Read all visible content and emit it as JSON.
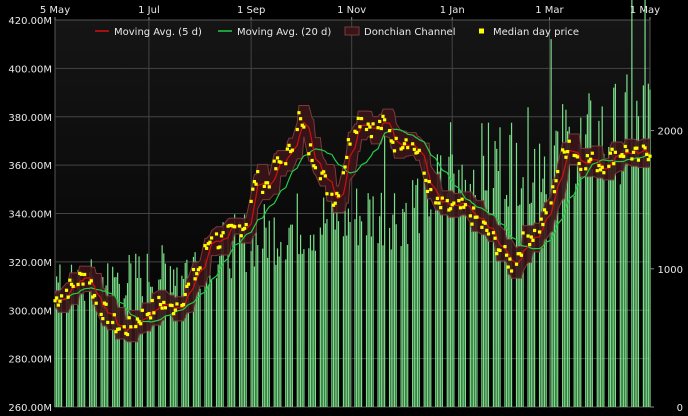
{
  "chart_data": {
    "type": "line",
    "grid": true,
    "legend_placement": "top",
    "colors": {
      "ma5": "#d01010",
      "ma20": "#22cc44",
      "donchian_fill": "#3a1418",
      "donchian_line": "#7a3a3a",
      "median": "#ffff00",
      "volume": "#7be08a",
      "plot_bg_top": "#101010",
      "plot_bg_bottom": "#000000",
      "grid": "#444444",
      "text": "#e8e8e8"
    },
    "x_axis": {
      "ticks": [
        "5 May",
        "1 Jul",
        "1 Sep",
        "1 Nov",
        "1 Jan",
        "1 Mar",
        "1 May"
      ],
      "tick_days": [
        0,
        57,
        119,
        180,
        241,
        300,
        361
      ],
      "range_days": [
        0,
        361
      ]
    },
    "y_axis": {
      "ticks": [
        "420.00M",
        "400.00M",
        "380.00M",
        "360.00M",
        "340.00M",
        "320.00M",
        "300.00M",
        "280.00M",
        "260.00M"
      ],
      "tick_values": [
        420,
        400,
        380,
        360,
        340,
        320,
        300,
        280,
        260
      ],
      "unit": "M",
      "range": [
        260,
        420
      ]
    },
    "volume_axis": {
      "ticks": [
        "2000",
        "1000",
        "0"
      ],
      "tick_values": [
        2000,
        1000,
        0
      ],
      "range": [
        0,
        2800
      ]
    },
    "legend": [
      {
        "name": "Moving Avg. (5 d)",
        "style": "line",
        "color": "#d01010"
      },
      {
        "name": "Moving Avg. (20 d)",
        "style": "line",
        "color": "#22cc44"
      },
      {
        "name": "Donchian Channel",
        "style": "channel",
        "color": "#7a3a3a"
      },
      {
        "name": "Median day price",
        "style": "marker",
        "color": "#ffff00"
      }
    ],
    "median_price_anchors": [
      [
        0,
        304
      ],
      [
        10,
        310
      ],
      [
        20,
        316
      ],
      [
        25,
        303
      ],
      [
        32,
        298
      ],
      [
        40,
        291
      ],
      [
        45,
        293
      ],
      [
        55,
        299
      ],
      [
        65,
        303
      ],
      [
        70,
        300
      ],
      [
        78,
        306
      ],
      [
        88,
        318
      ],
      [
        95,
        332
      ],
      [
        100,
        328
      ],
      [
        110,
        334
      ],
      [
        115,
        335
      ],
      [
        122,
        354
      ],
      [
        128,
        352
      ],
      [
        135,
        360
      ],
      [
        142,
        365
      ],
      [
        148,
        380
      ],
      [
        153,
        368
      ],
      [
        160,
        360
      ],
      [
        165,
        351
      ],
      [
        170,
        346
      ],
      [
        175,
        358
      ],
      [
        180,
        375
      ],
      [
        186,
        380
      ],
      [
        193,
        375
      ],
      [
        200,
        377
      ],
      [
        207,
        368
      ],
      [
        213,
        372
      ],
      [
        220,
        365
      ],
      [
        227,
        350
      ],
      [
        232,
        343
      ],
      [
        240,
        342
      ],
      [
        247,
        342
      ],
      [
        255,
        338
      ],
      [
        262,
        333
      ],
      [
        270,
        325
      ],
      [
        278,
        318
      ],
      [
        285,
        330
      ],
      [
        292,
        332
      ],
      [
        300,
        342
      ],
      [
        305,
        358
      ],
      [
        312,
        370
      ],
      [
        318,
        362
      ],
      [
        325,
        362
      ],
      [
        332,
        360
      ],
      [
        340,
        365
      ],
      [
        347,
        366
      ],
      [
        354,
        363
      ],
      [
        361,
        366
      ]
    ],
    "volume_profile": [
      [
        0,
        850
      ],
      [
        30,
        900
      ],
      [
        60,
        950
      ],
      [
        90,
        1050
      ],
      [
        120,
        1200
      ],
      [
        150,
        1300
      ],
      [
        180,
        1350
      ],
      [
        210,
        1400
      ],
      [
        240,
        1600
      ],
      [
        270,
        1750
      ],
      [
        300,
        1800
      ],
      [
        330,
        1900
      ],
      [
        361,
        2050
      ]
    ]
  }
}
